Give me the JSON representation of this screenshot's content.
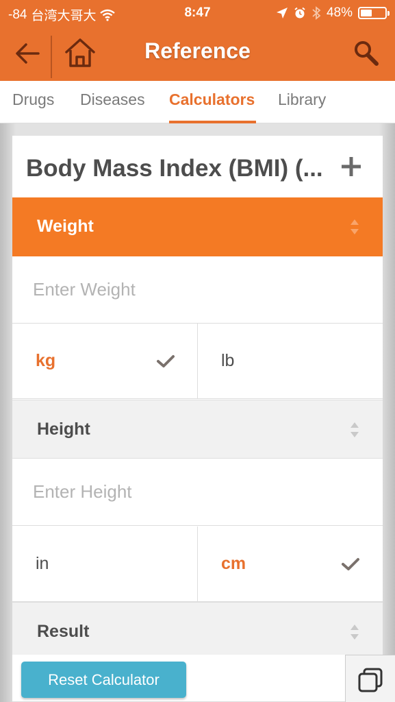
{
  "status_bar": {
    "signal": "-84",
    "carrier": "台湾大哥大",
    "time": "8:47",
    "battery": "48%",
    "battery_level": 0.48
  },
  "nav": {
    "title": "Reference",
    "back_icon": "back-arrow-icon",
    "home_icon": "home-icon",
    "search_icon": "search-icon"
  },
  "tabs": [
    {
      "label": "Drugs"
    },
    {
      "label": "Diseases"
    },
    {
      "label": "Calculators",
      "active": true
    },
    {
      "label": "Library"
    }
  ],
  "card": {
    "title": "Body Mass Index (BMI) (..."
  },
  "weight": {
    "header": "Weight",
    "placeholder": "Enter Weight",
    "units": [
      {
        "label": "kg",
        "selected": true
      },
      {
        "label": "lb",
        "selected": false
      }
    ]
  },
  "height": {
    "header": "Height",
    "placeholder": "Enter Height",
    "units": [
      {
        "label": "in",
        "selected": false
      },
      {
        "label": "cm",
        "selected": true
      }
    ]
  },
  "result": {
    "header": "Result"
  },
  "reset_button": "Reset Calculator",
  "colors": {
    "brand_orange": "#e8712e",
    "section_orange": "#f47a24",
    "reset_blue": "#49b1cd"
  }
}
